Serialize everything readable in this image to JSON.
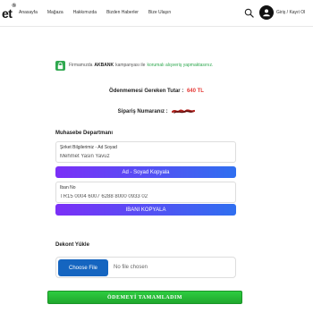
{
  "header": {
    "logo": "et",
    "logo_mark": "®",
    "nav": [
      "Anasayfa",
      "Mağaza",
      "Hakkımızda",
      "Bizden Haberler",
      "Bize Ulaşın"
    ],
    "login": "Giriş / Kayıt Ol"
  },
  "notice": {
    "prefix": "Firmamızda",
    "bank": "AKBANK",
    "middle": "kampanyası ile",
    "secure": "korumalı alışveriş yapmaktasınız."
  },
  "payment": {
    "amount_label": "Ödenmemesi Gereken Tutar :",
    "amount_value": "640 TL",
    "order_label": "Sipariş Numaranız :"
  },
  "accounting": {
    "title": "Muhasebe Departmanı",
    "company_label": "Şirket Bilgilerimiz - Ad Soyad",
    "company_value": "Mehmet Yasin Yavuz",
    "copy_name_button": "Ad - Soyad Kopyala",
    "iban_label": "Iban No",
    "iban_value": "TR15 0004 6007 6288 8000 0933 02",
    "copy_iban_button": "IBANI KOPYALA"
  },
  "upload": {
    "title": "Dekont Yükle",
    "choose_button": "Choose File",
    "status": "No file chosen"
  },
  "submit_button": "ÖDEMEYİ TAMAMLADIM",
  "colors": {
    "accent_green": "#2fa84f",
    "amount_red": "#e53935",
    "button_gradient_start": "#7b2ff7",
    "button_gradient_end": "#2f6ff0",
    "choose_file_blue": "#1565c0",
    "submit_green": "#2ecc40"
  },
  "icons": [
    "search-icon",
    "user-icon",
    "lock-icon"
  ]
}
